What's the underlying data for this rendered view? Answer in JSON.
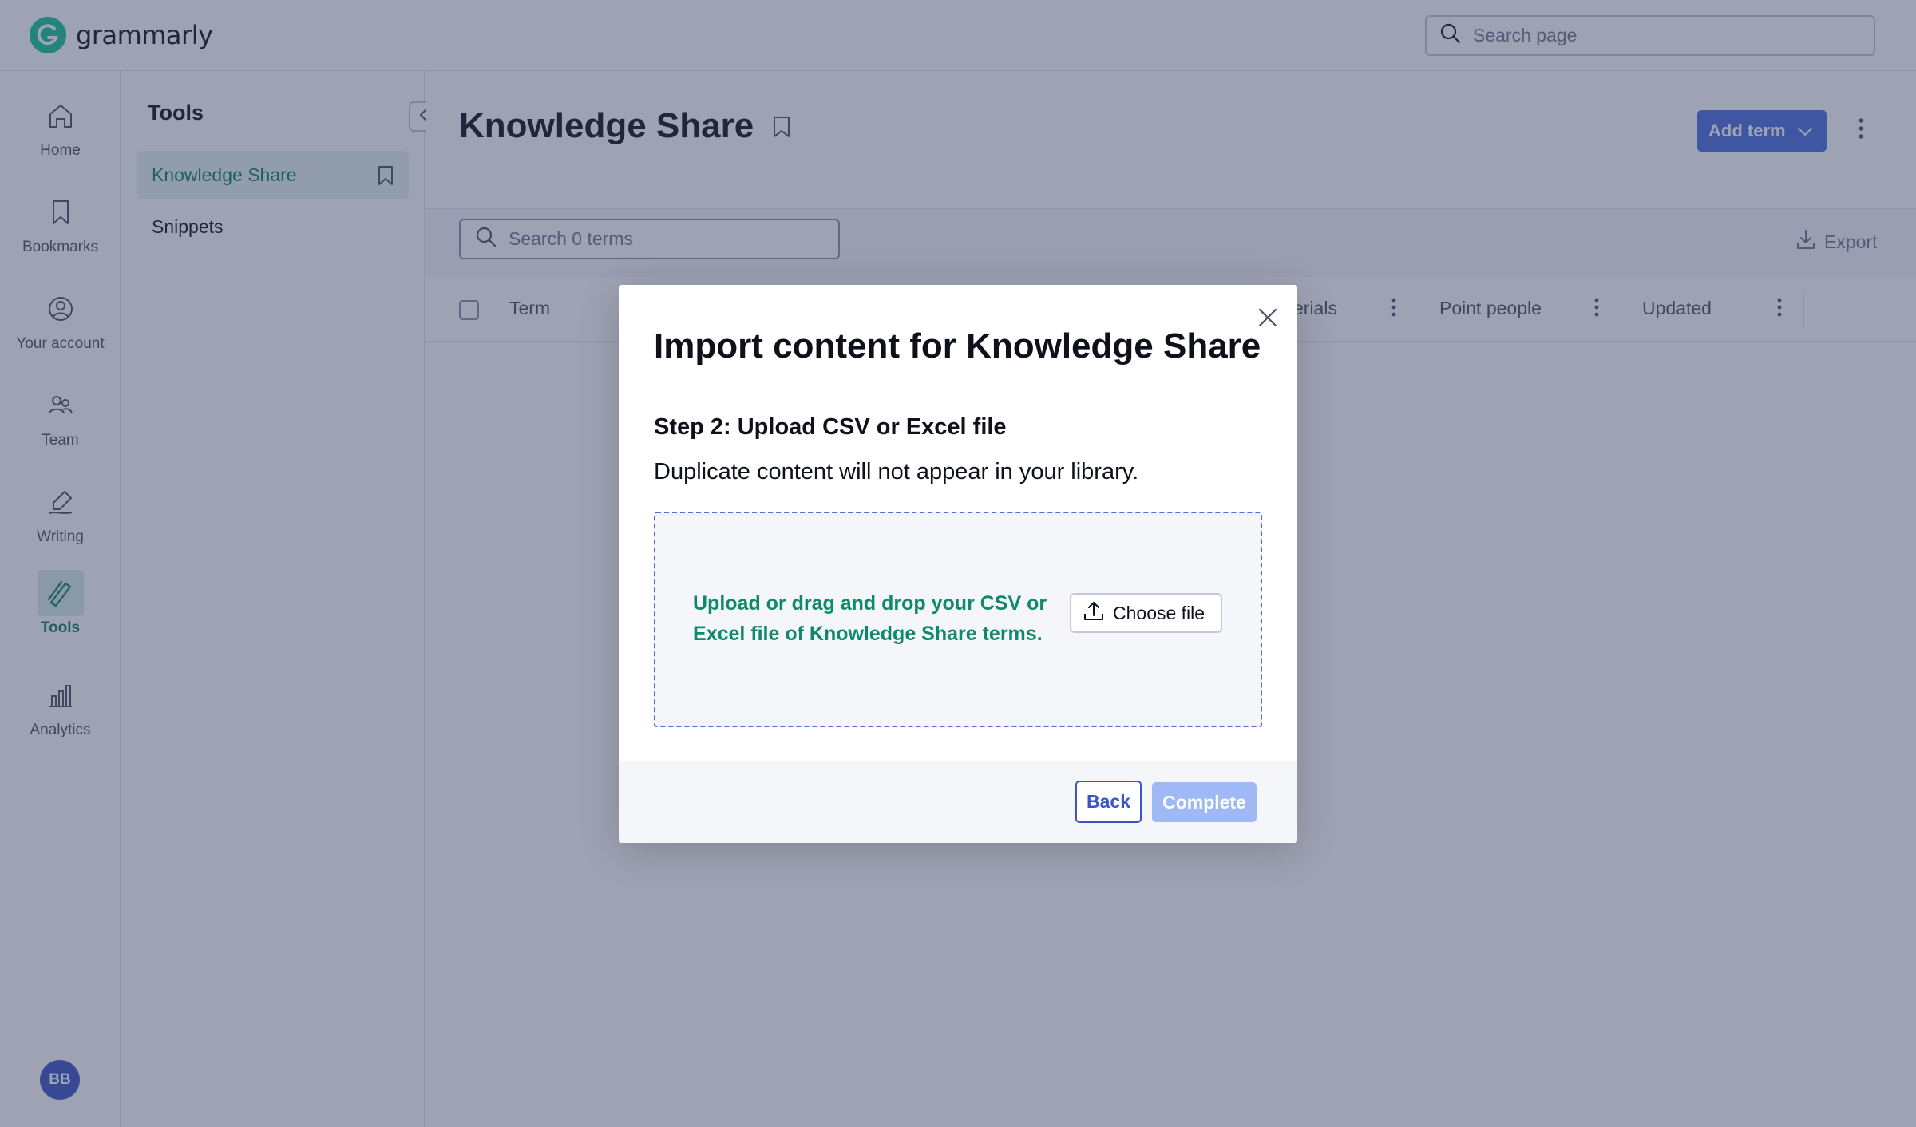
{
  "app": {
    "brand": "grammarly"
  },
  "search": {
    "placeholder": "Search page"
  },
  "rail": {
    "items": [
      {
        "label": "Home",
        "icon": "home-icon"
      },
      {
        "label": "Bookmarks",
        "icon": "bookmark-icon"
      },
      {
        "label": "Your account",
        "icon": "account-icon"
      },
      {
        "label": "Team",
        "icon": "team-icon"
      },
      {
        "label": "Writing",
        "icon": "pen-icon"
      },
      {
        "label": "Tools",
        "icon": "tools-icon",
        "active": true
      },
      {
        "label": "Analytics",
        "icon": "analytics-icon"
      }
    ],
    "avatar_initials": "BB"
  },
  "tools": {
    "title": "Tools",
    "items": [
      {
        "label": "Knowledge Share",
        "active": true
      },
      {
        "label": "Snippets"
      }
    ]
  },
  "main": {
    "title": "Knowledge Share",
    "add_term_label": "Add term",
    "terms_search_placeholder": "Search 0 terms",
    "export_label": "Export",
    "columns": [
      "Term",
      "erials",
      "Point people",
      "Updated"
    ]
  },
  "modal": {
    "title": "Import content for Knowledge Share",
    "step_title": "Step 2: Upload CSV or Excel file",
    "step_desc": "Duplicate content will not appear in your library.",
    "drop_text": "Upload or drag and drop your CSV or Excel file of Knowledge Share terms.",
    "choose_file_label": "Choose file",
    "back_label": "Back",
    "complete_label": "Complete"
  },
  "colors": {
    "brand_green": "#15c39a",
    "accent_blue": "#4a6ee0",
    "active_green_text": "#0e7b63",
    "overlay": "rgba(52,63,96,0.48)",
    "complete_disabled": "#9eb9f5"
  }
}
